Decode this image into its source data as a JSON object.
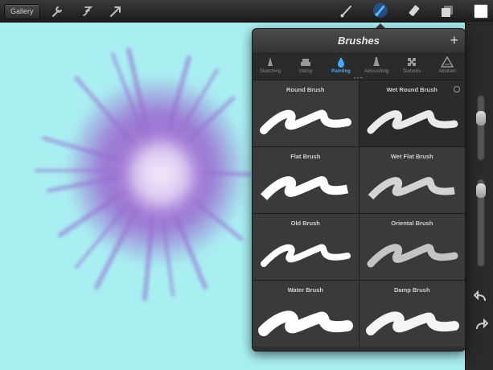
{
  "toolbar": {
    "gallery_label": "Gallery",
    "left_icons": [
      "wrench-icon",
      "adjust-icon",
      "transform-arrow-icon"
    ],
    "right_icons": [
      "brush-icon",
      "smudge-icon",
      "eraser-icon",
      "layers-icon",
      "color-swatch"
    ],
    "active_tool": "smudge"
  },
  "panel": {
    "title": "Brushes",
    "add_label": "+",
    "categories": [
      {
        "label": "Sketching",
        "icon": "pencil-icon",
        "active": false
      },
      {
        "label": "Inking",
        "icon": "ink-icon",
        "active": false
      },
      {
        "label": "Painting",
        "icon": "paint-drop-icon",
        "active": true
      },
      {
        "label": "Airbrushing",
        "icon": "airbrush-icon",
        "active": false
      },
      {
        "label": "Textures",
        "icon": "texture-icon",
        "active": false
      },
      {
        "label": "Abstract",
        "icon": "abstract-icon",
        "active": false
      }
    ],
    "brushes": [
      {
        "name": "Round Brush",
        "selected": false
      },
      {
        "name": "Wet Round Brush",
        "selected": true
      },
      {
        "name": "Flat Brush",
        "selected": false
      },
      {
        "name": "Wet Flat Brush",
        "selected": false
      },
      {
        "name": "Old Brush",
        "selected": false
      },
      {
        "name": "Oriental Brush",
        "selected": false
      },
      {
        "name": "Water Brush",
        "selected": false
      },
      {
        "name": "Damp Brush",
        "selected": false
      }
    ]
  },
  "colors": {
    "canvas": "#a9eff2",
    "paint": "#9a6ad0",
    "accent": "#4aa9ff"
  }
}
